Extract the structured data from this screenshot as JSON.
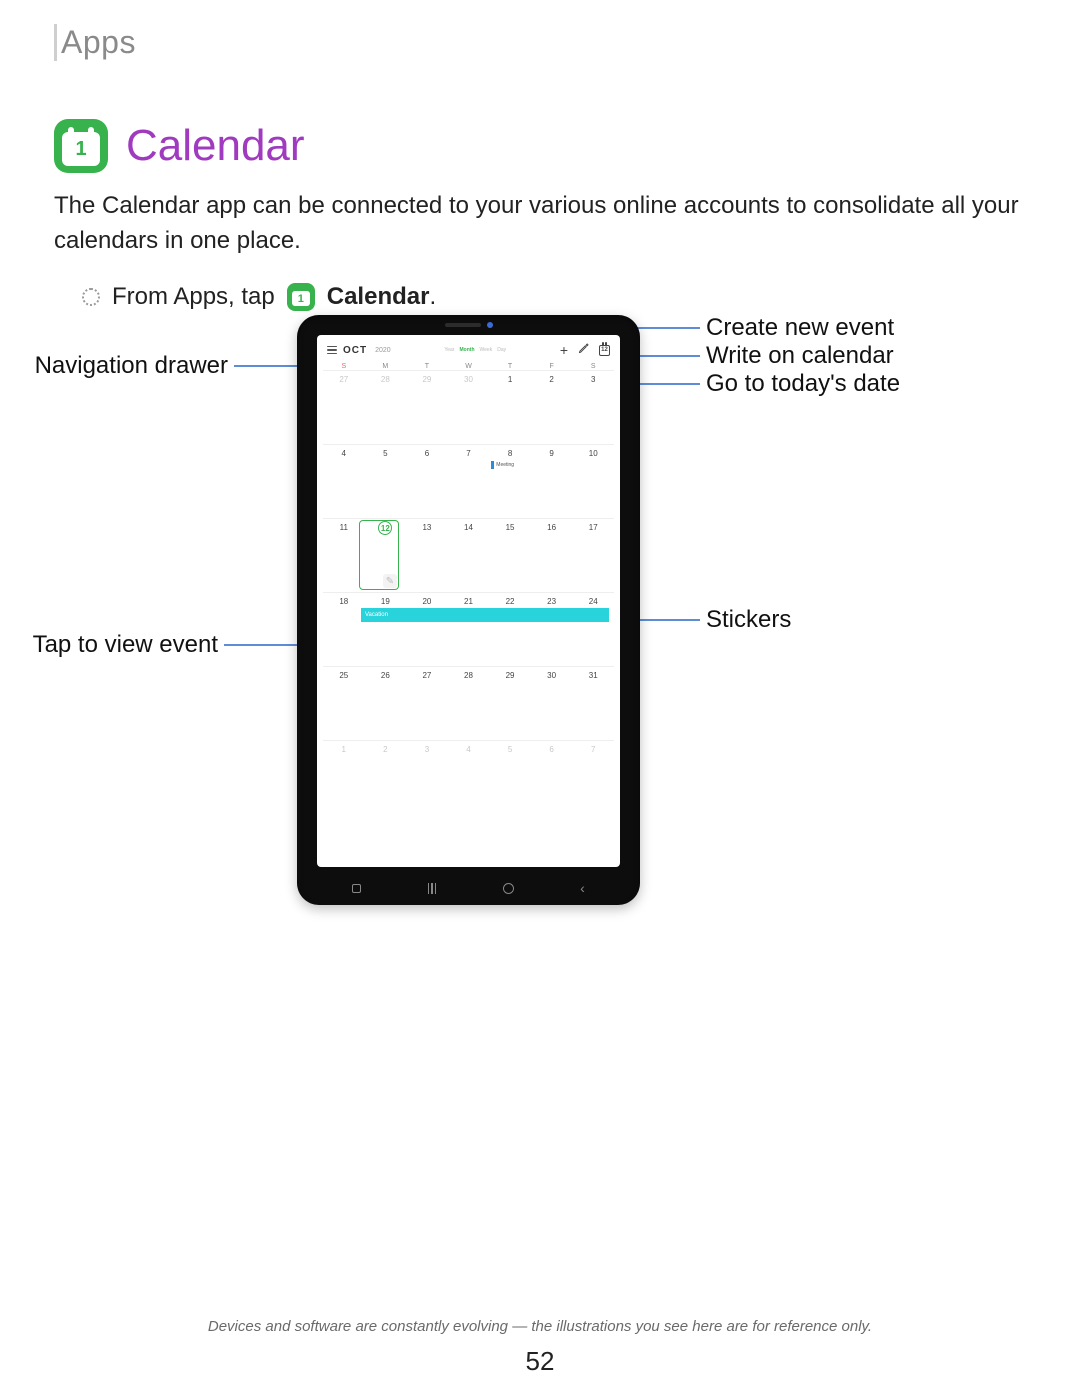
{
  "section": "Apps",
  "heading": "Calendar",
  "icon_number": "1",
  "intro": "The Calendar app can be connected to your various online accounts to consolidate all your calendars in one place.",
  "step_prefix": "From Apps, tap",
  "step_app": "Calendar",
  "callouts": {
    "nav_drawer": "Navigation drawer",
    "tap_event": "Tap to view event",
    "create_event": "Create new event",
    "write_cal": "Write on calendar",
    "today": "Go to today's date",
    "stickers": "Stickers"
  },
  "calendar": {
    "month": "OCT",
    "year": "2020",
    "views": [
      "Year",
      "Month",
      "Week",
      "Day"
    ],
    "active_view": "Month",
    "weekdays": [
      "S",
      "M",
      "T",
      "W",
      "T",
      "F",
      "S"
    ],
    "today_icon_num": "12",
    "meeting_label": "Meeting",
    "event_label": "Vacation",
    "rows": [
      {
        "type": "dim",
        "days": [
          27,
          28,
          29,
          30,
          1,
          2,
          3
        ],
        "dim_first": 4,
        "today_idx": 4
      },
      {
        "type": "norm",
        "days": [
          4,
          5,
          6,
          7,
          8,
          9,
          10
        ],
        "meeting_idx": 4
      },
      {
        "type": "norm",
        "days": [
          11,
          12,
          13,
          14,
          15,
          16,
          17
        ],
        "selected_idx": 1
      },
      {
        "type": "norm",
        "days": [
          18,
          19,
          20,
          21,
          22,
          23,
          24
        ],
        "event": true
      },
      {
        "type": "norm",
        "days": [
          25,
          26,
          27,
          28,
          29,
          30,
          31
        ]
      },
      {
        "type": "dim",
        "days": [
          1,
          2,
          3,
          4,
          5,
          6,
          7
        ],
        "dim_first": 7
      }
    ]
  },
  "disclaimer": "Devices and software are constantly evolving — the illustrations you see here are for reference only.",
  "page_number": "52"
}
